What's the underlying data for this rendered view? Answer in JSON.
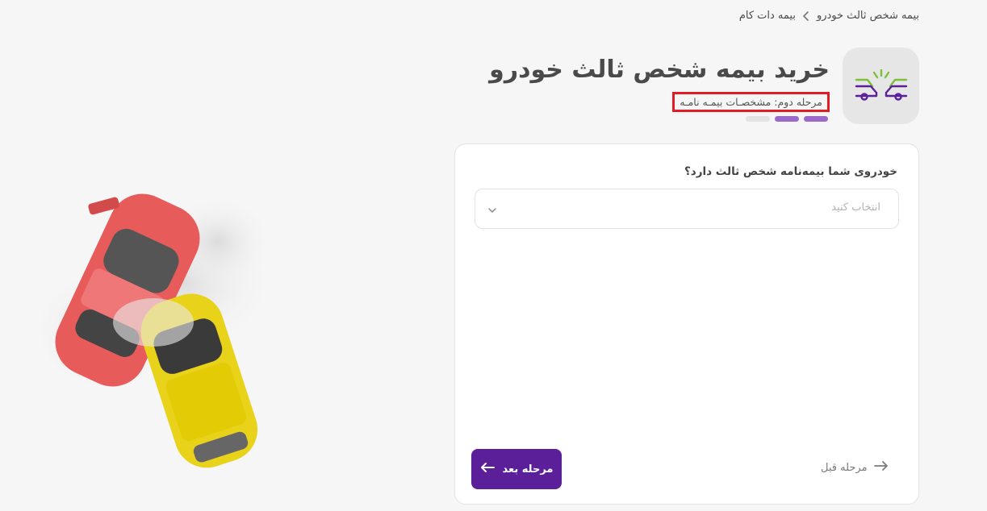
{
  "breadcrumb": {
    "home": "بیمه دات کام",
    "current": "بیمه شخص ثالث خودرو"
  },
  "header": {
    "title": "خرید بیمه شخص ثالث خودرو",
    "subtitle": "مرحله دوم: مشخصـات بیمـه نامـه",
    "logo_icon": "car-crash-icon"
  },
  "progress": {
    "steps": [
      {
        "state": "done",
        "color": "#9b6ac9"
      },
      {
        "state": "active",
        "color": "#9b6ac9"
      },
      {
        "state": "pending",
        "color": "#e3e3e3"
      }
    ]
  },
  "form": {
    "question": "خودروی شما بیمه‌نامه شخص ثالث دارد؟",
    "select_placeholder": "انتخاب کنید"
  },
  "actions": {
    "next_label": "مرحله بعد",
    "prev_label": "مرحله قبل"
  },
  "colors": {
    "accent": "#5b1f9a",
    "highlight": "#e01d24",
    "logo_green": "#7bbf3a"
  }
}
